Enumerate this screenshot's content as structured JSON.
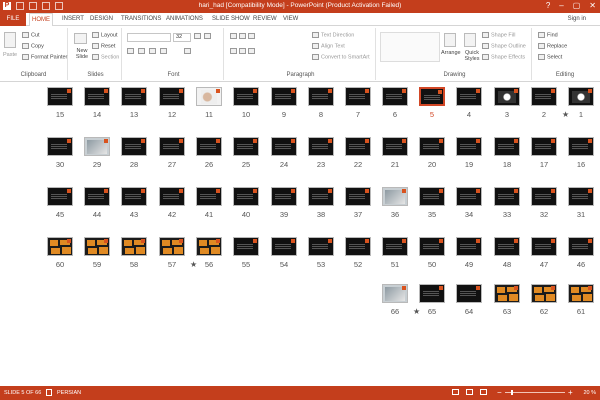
{
  "titlebar": {
    "title": "hari_had [Compatibility Mode] - PowerPoint (Product Activation Failed)",
    "logo_letter": "P"
  },
  "tabs": [
    "FILE",
    "HOME",
    "INSERT",
    "DESIGN",
    "TRANSITIONS",
    "ANIMATIONS",
    "SLIDE SHOW",
    "REVIEW",
    "VIEW"
  ],
  "active_tab": "HOME",
  "signin": "Sign in",
  "window_controls": [
    "?",
    "–",
    "▢",
    "✕"
  ],
  "ribbon": {
    "clipboard": {
      "paste": "Paste",
      "cut": "Cut",
      "copy": "Copy",
      "format_painter": "Format Painter",
      "label": "Clipboard"
    },
    "slides": {
      "new_slide": "New Slide",
      "layout": "Layout",
      "reset": "Reset",
      "section": "Section",
      "label": "Slides"
    },
    "font": {
      "size": "32",
      "label": "Font"
    },
    "paragraph": {
      "text_direction": "Text Direction",
      "align_text": "Align Text",
      "smartart": "Convert to SmartArt",
      "label": "Paragraph"
    },
    "drawing": {
      "arrange": "Arrange",
      "quick_styles": "Quick Styles",
      "shape_fill": "Shape Fill",
      "shape_outline": "Shape Outline",
      "shape_effects": "Shape Effects",
      "label": "Drawing"
    },
    "editing": {
      "find": "Find",
      "replace": "Replace",
      "select": "Select",
      "label": "Editing"
    }
  },
  "slides": {
    "row1": [
      15,
      14,
      13,
      12,
      11,
      10,
      9,
      8,
      7,
      6,
      5,
      4,
      3,
      2,
      1
    ],
    "row2": [
      30,
      29,
      28,
      27,
      26,
      25,
      24,
      23,
      22,
      21,
      20,
      19,
      18,
      17,
      16
    ],
    "row3": [
      45,
      44,
      43,
      42,
      41,
      40,
      39,
      38,
      37,
      36,
      35,
      34,
      33,
      32,
      31
    ],
    "row4": [
      60,
      59,
      58,
      57,
      56,
      55,
      54,
      53,
      52,
      51,
      50,
      49,
      48,
      47,
      46
    ],
    "row5": [
      66,
      65,
      64,
      63,
      62,
      61
    ],
    "selected": 5,
    "starred": [
      1,
      56,
      65
    ]
  },
  "status": {
    "slide_info": "SLIDE 5 OF 66",
    "language": "PERSIAN",
    "zoom": "20 %"
  },
  "colors": {
    "accent": "#c43e1c",
    "selection": "#d24726"
  }
}
